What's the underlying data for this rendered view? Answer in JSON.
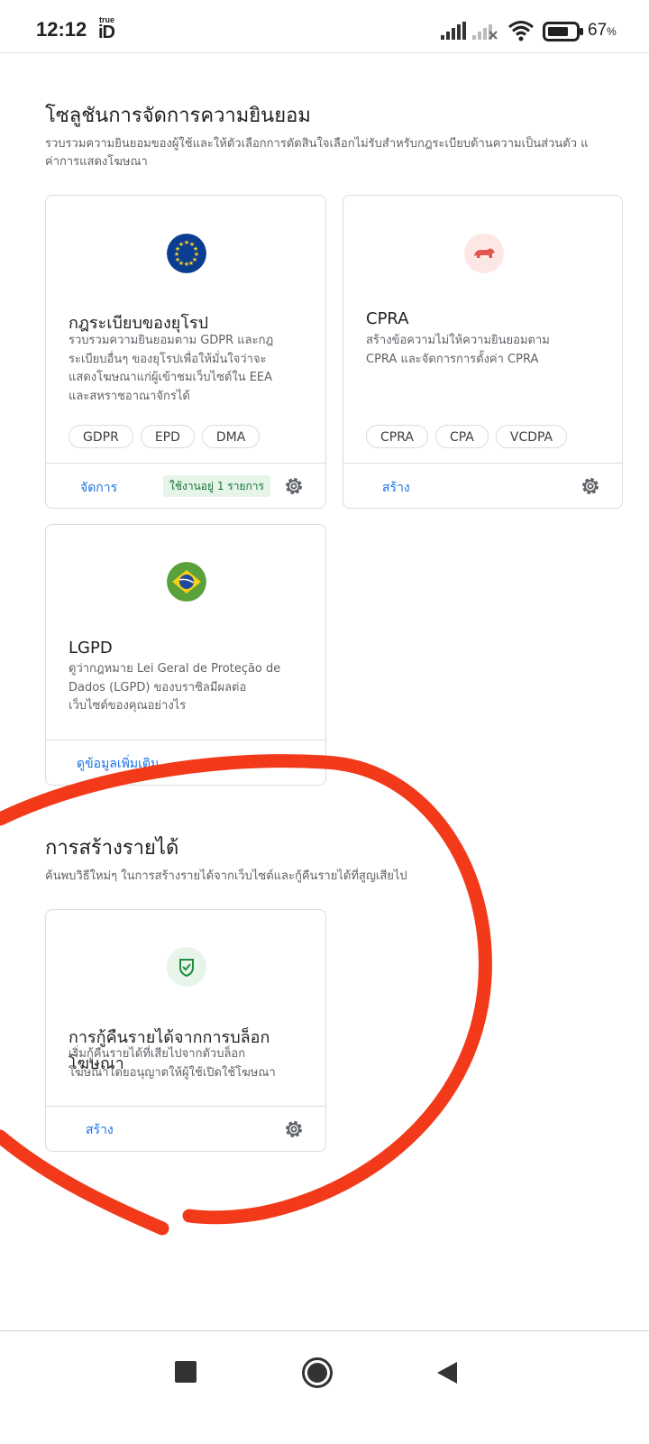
{
  "status_bar": {
    "time": "12:12",
    "carrier_logo_top": "true",
    "carrier_logo_bottom": "iD",
    "battery_percent": "67",
    "battery_unit": "%"
  },
  "privacy_section": {
    "title": "โซลูชันการจัดการความยินยอม",
    "description_line1": "รวบรวมความยินยอมของผู้ใช้และให้ตัวเลือกการตัดสินใจเลือกไม่รับสำหรับกฎระเบียบด้านความเป็นส่วนตัว แ",
    "description_line2": "ค่าการแสดงโฆษณา"
  },
  "cards": {
    "europe": {
      "icon": "eu-flag-icon",
      "title": "กฎระเบียบของยุโรป",
      "desc_lines": [
        "รวบรวมความยินยอมตาม GDPR และกฎ",
        "ระเบียบอื่นๆ ของยุโรปเพื่อให้มั่นใจว่าจะ",
        "แสดงโฆษณาแก่ผู้เข้าชมเว็บไซต์ใน EEA",
        "และสหราชอาณาจักรได้"
      ],
      "chips": [
        "GDPR",
        "EPD",
        "DMA"
      ],
      "action": "จัดการ",
      "badge": "ใช้งานอยู่ 1 รายการ"
    },
    "cpra": {
      "icon": "california-bear-icon",
      "title": "CPRA",
      "desc_lines": [
        "สร้างข้อความไม่ให้ความยินยอมตาม",
        "CPRA และจัดการการตั้งค่า CPRA"
      ],
      "chips": [
        "CPRA",
        "CPA",
        "VCDPA"
      ],
      "action": "สร้าง"
    },
    "lgpd": {
      "icon": "brazil-flag-icon",
      "title": "LGPD",
      "desc_lines": [
        "ดูว่ากฎหมาย Lei Geral de Proteção de",
        "Dados (LGPD) ของบราซิลมีผลต่อ",
        "เว็บไซต์ของคุณอย่างไร"
      ],
      "action": "ดูข้อมูลเพิ่มเติม"
    },
    "revenue_recovery": {
      "icon": "shield-check-icon",
      "title": "การกู้คืนรายได้จากการบล็อกโฆษณา",
      "desc_lines": [
        "เริ่มกู้คืนรายได้ที่เสียไปจากตัวบล็อก",
        "โฆษณาโดยอนุญาตให้ผู้ใช้เปิดใช้โฆษณา"
      ],
      "action": "สร้าง"
    }
  },
  "monetization_section": {
    "title": "การสร้างรายได้",
    "description": "ค้นพบวิธีใหม่ๆ ในการสร้างรายได้จากเว็บไซต์และกู้คืนรายได้ที่สูญเสียไป"
  },
  "colors": {
    "link": "#1a73e8",
    "annotation": "#f23a1a",
    "badge_bg": "#e6f4ea",
    "badge_text": "#137333"
  }
}
